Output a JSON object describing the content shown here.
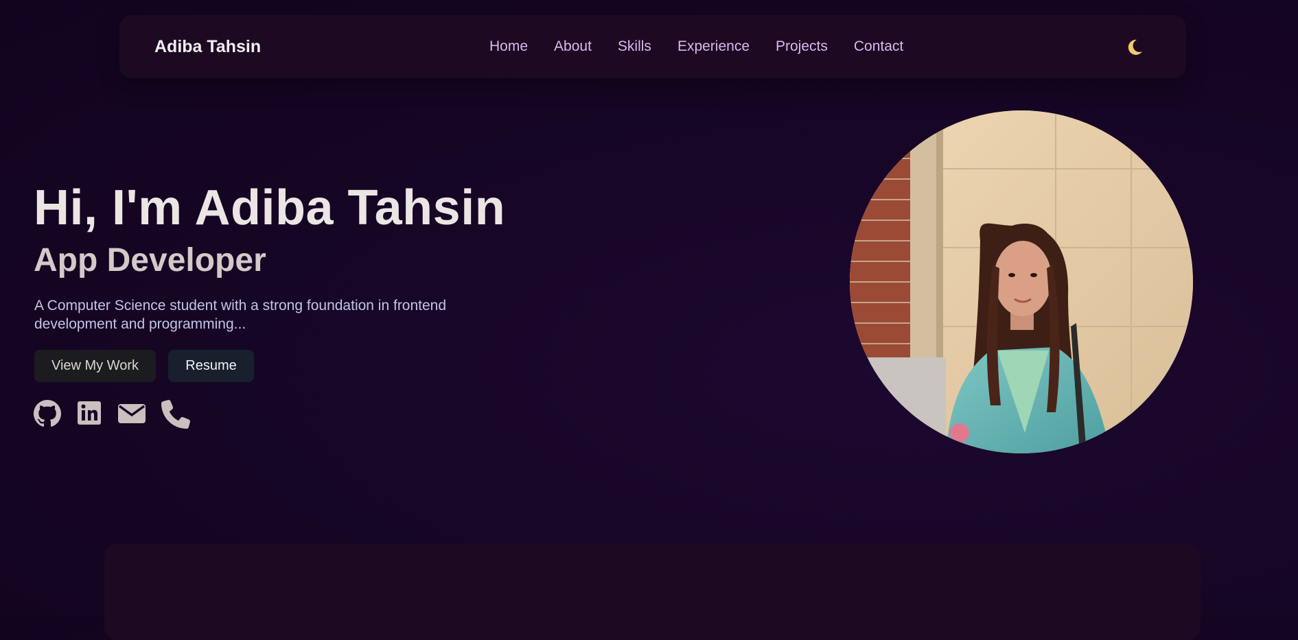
{
  "nav": {
    "brand": "Adiba Tahsin",
    "links": [
      "Home",
      "About",
      "Skills",
      "Experience",
      "Projects",
      "Contact"
    ],
    "theme_toggle_icon": "crescent-moon-icon"
  },
  "hero": {
    "title": "Hi, I'm Adiba Tahsin",
    "subtitle": "App Developer",
    "description": "A Computer Science student with a strong foundation in frontend development and programming...",
    "primary_button": "View My Work",
    "secondary_button": "Resume",
    "social_icons": [
      "github-icon",
      "linkedin-icon",
      "email-icon",
      "phone-icon"
    ]
  },
  "colors": {
    "background": "#160624",
    "nav_background": "#1d0a22",
    "nav_link": "#d9b8f0",
    "heading": "#ebe6e4",
    "subheading": "#d3cac9",
    "description": "#c3c5e6",
    "icon": "#c9c0bf",
    "moon": "#f5c96a"
  }
}
